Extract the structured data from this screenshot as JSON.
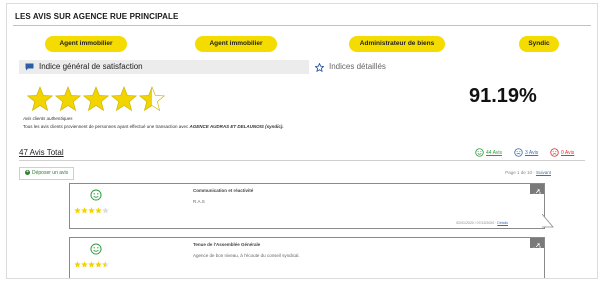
{
  "header": {
    "title": "LES AVIS SUR AGENCE RUE PRINCIPALE"
  },
  "categories": [
    "Agent immobilier",
    "Agent immobilier",
    "Administrateur de biens",
    "Syndic"
  ],
  "tabs": {
    "general": "Indice général de satisfaction",
    "details": "Indices détaillés"
  },
  "rating": {
    "score": "91.19%",
    "stars": 4.5
  },
  "info": {
    "authentic": "Avis clients authentiques",
    "description": "Tous les avis clients proviennent de personnes ayant effectué une transaction avec",
    "agency": "AGENCE AUDRAS ET DELAUNOIS (syndic)."
  },
  "summary": {
    "total": "47 Avis Total",
    "positive": "44 Avis",
    "neutral": "3 Avis",
    "negative": "0 Avis"
  },
  "actions": {
    "post_review": "Déposer un avis"
  },
  "pagination": {
    "text": "Page 1 de 10 ·",
    "next": "Suivant"
  },
  "reviews": [
    {
      "title": "Communication et réactivité",
      "text": "R.A.S",
      "stars": 4,
      "dates": "02/01/2020 / 07/12/2020 ·",
      "details": "Détails"
    },
    {
      "title": "Tenue de l'Assemblée Générale",
      "text": "Agence de bon niveau, à l'écoute du conseil syndical.",
      "stars": 4.5
    }
  ],
  "colors": {
    "accent": "#f4dc00",
    "positive": "#2e9b3a",
    "neutral": "#3b6fb6",
    "negative": "#d33"
  }
}
